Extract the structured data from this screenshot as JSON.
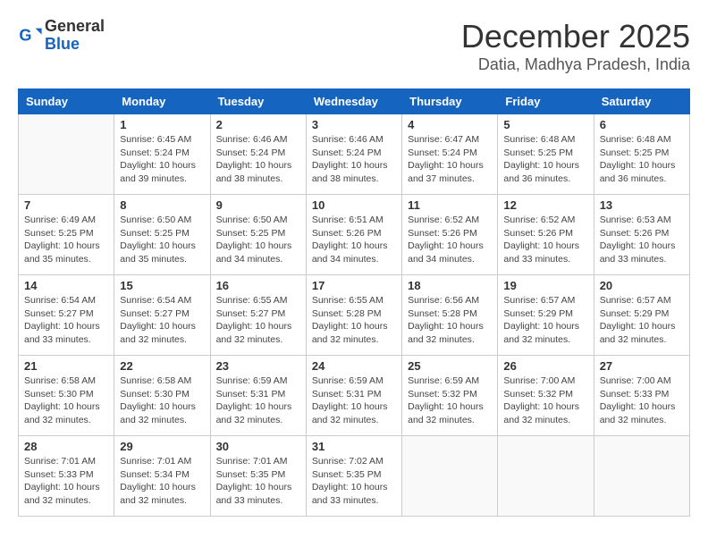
{
  "logo": {
    "general": "General",
    "blue": "Blue"
  },
  "title": {
    "month_year": "December 2025",
    "location": "Datia, Madhya Pradesh, India"
  },
  "headers": [
    "Sunday",
    "Monday",
    "Tuesday",
    "Wednesday",
    "Thursday",
    "Friday",
    "Saturday"
  ],
  "weeks": [
    [
      {
        "day": "",
        "info": ""
      },
      {
        "day": "1",
        "info": "Sunrise: 6:45 AM\nSunset: 5:24 PM\nDaylight: 10 hours\nand 39 minutes."
      },
      {
        "day": "2",
        "info": "Sunrise: 6:46 AM\nSunset: 5:24 PM\nDaylight: 10 hours\nand 38 minutes."
      },
      {
        "day": "3",
        "info": "Sunrise: 6:46 AM\nSunset: 5:24 PM\nDaylight: 10 hours\nand 38 minutes."
      },
      {
        "day": "4",
        "info": "Sunrise: 6:47 AM\nSunset: 5:24 PM\nDaylight: 10 hours\nand 37 minutes."
      },
      {
        "day": "5",
        "info": "Sunrise: 6:48 AM\nSunset: 5:25 PM\nDaylight: 10 hours\nand 36 minutes."
      },
      {
        "day": "6",
        "info": "Sunrise: 6:48 AM\nSunset: 5:25 PM\nDaylight: 10 hours\nand 36 minutes."
      }
    ],
    [
      {
        "day": "7",
        "info": "Sunrise: 6:49 AM\nSunset: 5:25 PM\nDaylight: 10 hours\nand 35 minutes."
      },
      {
        "day": "8",
        "info": "Sunrise: 6:50 AM\nSunset: 5:25 PM\nDaylight: 10 hours\nand 35 minutes."
      },
      {
        "day": "9",
        "info": "Sunrise: 6:50 AM\nSunset: 5:25 PM\nDaylight: 10 hours\nand 34 minutes."
      },
      {
        "day": "10",
        "info": "Sunrise: 6:51 AM\nSunset: 5:26 PM\nDaylight: 10 hours\nand 34 minutes."
      },
      {
        "day": "11",
        "info": "Sunrise: 6:52 AM\nSunset: 5:26 PM\nDaylight: 10 hours\nand 34 minutes."
      },
      {
        "day": "12",
        "info": "Sunrise: 6:52 AM\nSunset: 5:26 PM\nDaylight: 10 hours\nand 33 minutes."
      },
      {
        "day": "13",
        "info": "Sunrise: 6:53 AM\nSunset: 5:26 PM\nDaylight: 10 hours\nand 33 minutes."
      }
    ],
    [
      {
        "day": "14",
        "info": "Sunrise: 6:54 AM\nSunset: 5:27 PM\nDaylight: 10 hours\nand 33 minutes."
      },
      {
        "day": "15",
        "info": "Sunrise: 6:54 AM\nSunset: 5:27 PM\nDaylight: 10 hours\nand 32 minutes."
      },
      {
        "day": "16",
        "info": "Sunrise: 6:55 AM\nSunset: 5:27 PM\nDaylight: 10 hours\nand 32 minutes."
      },
      {
        "day": "17",
        "info": "Sunrise: 6:55 AM\nSunset: 5:28 PM\nDaylight: 10 hours\nand 32 minutes."
      },
      {
        "day": "18",
        "info": "Sunrise: 6:56 AM\nSunset: 5:28 PM\nDaylight: 10 hours\nand 32 minutes."
      },
      {
        "day": "19",
        "info": "Sunrise: 6:57 AM\nSunset: 5:29 PM\nDaylight: 10 hours\nand 32 minutes."
      },
      {
        "day": "20",
        "info": "Sunrise: 6:57 AM\nSunset: 5:29 PM\nDaylight: 10 hours\nand 32 minutes."
      }
    ],
    [
      {
        "day": "21",
        "info": "Sunrise: 6:58 AM\nSunset: 5:30 PM\nDaylight: 10 hours\nand 32 minutes."
      },
      {
        "day": "22",
        "info": "Sunrise: 6:58 AM\nSunset: 5:30 PM\nDaylight: 10 hours\nand 32 minutes."
      },
      {
        "day": "23",
        "info": "Sunrise: 6:59 AM\nSunset: 5:31 PM\nDaylight: 10 hours\nand 32 minutes."
      },
      {
        "day": "24",
        "info": "Sunrise: 6:59 AM\nSunset: 5:31 PM\nDaylight: 10 hours\nand 32 minutes."
      },
      {
        "day": "25",
        "info": "Sunrise: 6:59 AM\nSunset: 5:32 PM\nDaylight: 10 hours\nand 32 minutes."
      },
      {
        "day": "26",
        "info": "Sunrise: 7:00 AM\nSunset: 5:32 PM\nDaylight: 10 hours\nand 32 minutes."
      },
      {
        "day": "27",
        "info": "Sunrise: 7:00 AM\nSunset: 5:33 PM\nDaylight: 10 hours\nand 32 minutes."
      }
    ],
    [
      {
        "day": "28",
        "info": "Sunrise: 7:01 AM\nSunset: 5:33 PM\nDaylight: 10 hours\nand 32 minutes."
      },
      {
        "day": "29",
        "info": "Sunrise: 7:01 AM\nSunset: 5:34 PM\nDaylight: 10 hours\nand 32 minutes."
      },
      {
        "day": "30",
        "info": "Sunrise: 7:01 AM\nSunset: 5:35 PM\nDaylight: 10 hours\nand 33 minutes."
      },
      {
        "day": "31",
        "info": "Sunrise: 7:02 AM\nSunset: 5:35 PM\nDaylight: 10 hours\nand 33 minutes."
      },
      {
        "day": "",
        "info": ""
      },
      {
        "day": "",
        "info": ""
      },
      {
        "day": "",
        "info": ""
      }
    ]
  ]
}
